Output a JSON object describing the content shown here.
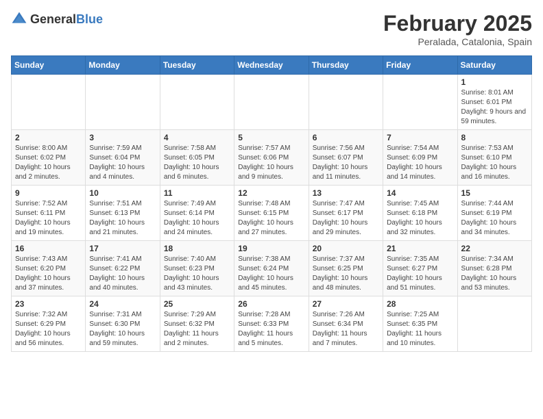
{
  "header": {
    "logo_general": "General",
    "logo_blue": "Blue",
    "month_year": "February 2025",
    "location": "Peralada, Catalonia, Spain"
  },
  "days_of_week": [
    "Sunday",
    "Monday",
    "Tuesday",
    "Wednesday",
    "Thursday",
    "Friday",
    "Saturday"
  ],
  "weeks": [
    [
      {
        "day": "",
        "info": ""
      },
      {
        "day": "",
        "info": ""
      },
      {
        "day": "",
        "info": ""
      },
      {
        "day": "",
        "info": ""
      },
      {
        "day": "",
        "info": ""
      },
      {
        "day": "",
        "info": ""
      },
      {
        "day": "1",
        "info": "Sunrise: 8:01 AM\nSunset: 6:01 PM\nDaylight: 9 hours and 59 minutes."
      }
    ],
    [
      {
        "day": "2",
        "info": "Sunrise: 8:00 AM\nSunset: 6:02 PM\nDaylight: 10 hours and 2 minutes."
      },
      {
        "day": "3",
        "info": "Sunrise: 7:59 AM\nSunset: 6:04 PM\nDaylight: 10 hours and 4 minutes."
      },
      {
        "day": "4",
        "info": "Sunrise: 7:58 AM\nSunset: 6:05 PM\nDaylight: 10 hours and 6 minutes."
      },
      {
        "day": "5",
        "info": "Sunrise: 7:57 AM\nSunset: 6:06 PM\nDaylight: 10 hours and 9 minutes."
      },
      {
        "day": "6",
        "info": "Sunrise: 7:56 AM\nSunset: 6:07 PM\nDaylight: 10 hours and 11 minutes."
      },
      {
        "day": "7",
        "info": "Sunrise: 7:54 AM\nSunset: 6:09 PM\nDaylight: 10 hours and 14 minutes."
      },
      {
        "day": "8",
        "info": "Sunrise: 7:53 AM\nSunset: 6:10 PM\nDaylight: 10 hours and 16 minutes."
      }
    ],
    [
      {
        "day": "9",
        "info": "Sunrise: 7:52 AM\nSunset: 6:11 PM\nDaylight: 10 hours and 19 minutes."
      },
      {
        "day": "10",
        "info": "Sunrise: 7:51 AM\nSunset: 6:13 PM\nDaylight: 10 hours and 21 minutes."
      },
      {
        "day": "11",
        "info": "Sunrise: 7:49 AM\nSunset: 6:14 PM\nDaylight: 10 hours and 24 minutes."
      },
      {
        "day": "12",
        "info": "Sunrise: 7:48 AM\nSunset: 6:15 PM\nDaylight: 10 hours and 27 minutes."
      },
      {
        "day": "13",
        "info": "Sunrise: 7:47 AM\nSunset: 6:17 PM\nDaylight: 10 hours and 29 minutes."
      },
      {
        "day": "14",
        "info": "Sunrise: 7:45 AM\nSunset: 6:18 PM\nDaylight: 10 hours and 32 minutes."
      },
      {
        "day": "15",
        "info": "Sunrise: 7:44 AM\nSunset: 6:19 PM\nDaylight: 10 hours and 34 minutes."
      }
    ],
    [
      {
        "day": "16",
        "info": "Sunrise: 7:43 AM\nSunset: 6:20 PM\nDaylight: 10 hours and 37 minutes."
      },
      {
        "day": "17",
        "info": "Sunrise: 7:41 AM\nSunset: 6:22 PM\nDaylight: 10 hours and 40 minutes."
      },
      {
        "day": "18",
        "info": "Sunrise: 7:40 AM\nSunset: 6:23 PM\nDaylight: 10 hours and 43 minutes."
      },
      {
        "day": "19",
        "info": "Sunrise: 7:38 AM\nSunset: 6:24 PM\nDaylight: 10 hours and 45 minutes."
      },
      {
        "day": "20",
        "info": "Sunrise: 7:37 AM\nSunset: 6:25 PM\nDaylight: 10 hours and 48 minutes."
      },
      {
        "day": "21",
        "info": "Sunrise: 7:35 AM\nSunset: 6:27 PM\nDaylight: 10 hours and 51 minutes."
      },
      {
        "day": "22",
        "info": "Sunrise: 7:34 AM\nSunset: 6:28 PM\nDaylight: 10 hours and 53 minutes."
      }
    ],
    [
      {
        "day": "23",
        "info": "Sunrise: 7:32 AM\nSunset: 6:29 PM\nDaylight: 10 hours and 56 minutes."
      },
      {
        "day": "24",
        "info": "Sunrise: 7:31 AM\nSunset: 6:30 PM\nDaylight: 10 hours and 59 minutes."
      },
      {
        "day": "25",
        "info": "Sunrise: 7:29 AM\nSunset: 6:32 PM\nDaylight: 11 hours and 2 minutes."
      },
      {
        "day": "26",
        "info": "Sunrise: 7:28 AM\nSunset: 6:33 PM\nDaylight: 11 hours and 5 minutes."
      },
      {
        "day": "27",
        "info": "Sunrise: 7:26 AM\nSunset: 6:34 PM\nDaylight: 11 hours and 7 minutes."
      },
      {
        "day": "28",
        "info": "Sunrise: 7:25 AM\nSunset: 6:35 PM\nDaylight: 11 hours and 10 minutes."
      },
      {
        "day": "",
        "info": ""
      }
    ]
  ]
}
